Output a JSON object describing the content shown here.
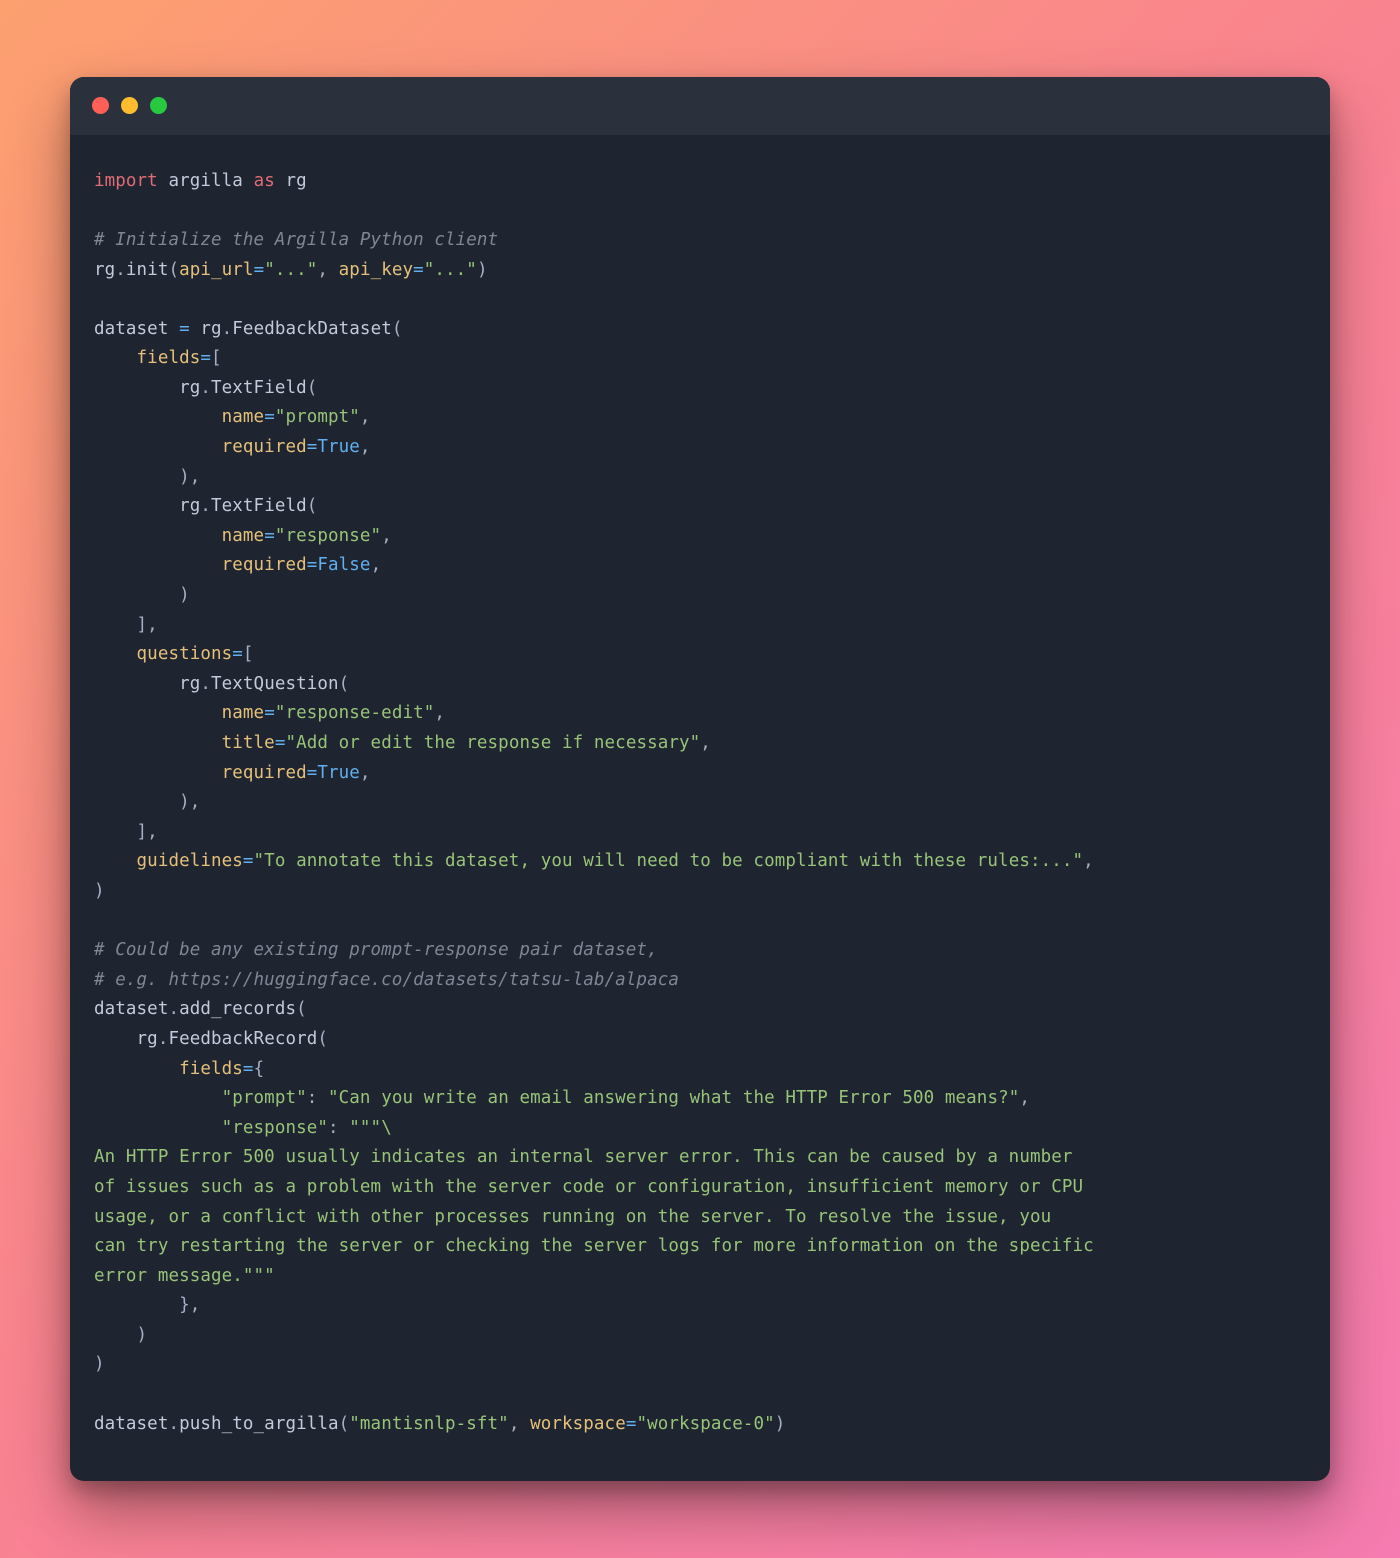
{
  "window": {
    "controls": [
      "close",
      "minimize",
      "zoom"
    ]
  },
  "code": {
    "line1": {
      "kw1": "import",
      "mod": "argilla",
      "kw2": "as",
      "alias": "rg"
    },
    "cmt_init": "# Initialize the Argilla Python client",
    "line_init": {
      "obj": "rg",
      "fn": "init",
      "p1": "api_url",
      "v1": "\"...\"",
      "p2": "api_key",
      "v2": "\"...\""
    },
    "ds_assign": {
      "var": "dataset",
      "cls": "rg",
      "ctor": "FeedbackDataset"
    },
    "fields_kw": "fields",
    "tf1": {
      "cls": "rg",
      "ctor": "TextField",
      "name_kw": "name",
      "name_v": "\"prompt\"",
      "req_kw": "required",
      "req_v": "True"
    },
    "tf2": {
      "cls": "rg",
      "ctor": "TextField",
      "name_kw": "name",
      "name_v": "\"response\"",
      "req_kw": "required",
      "req_v": "False"
    },
    "questions_kw": "questions",
    "tq": {
      "cls": "rg",
      "ctor": "TextQuestion",
      "name_kw": "name",
      "name_v": "\"response-edit\"",
      "title_kw": "title",
      "title_v": "\"Add or edit the response if necessary\"",
      "req_kw": "required",
      "req_v": "True"
    },
    "guidelines_kw": "guidelines",
    "guidelines_v": "\"To annotate this dataset, you will need to be compliant with these rules:...\"",
    "cmt_ds1": "# Could be any existing prompt-response pair dataset,",
    "cmt_ds2": "# e.g. https://huggingface.co/datasets/tatsu-lab/alpaca",
    "add": {
      "obj": "dataset",
      "fn": "add_records",
      "rec_cls": "rg",
      "rec_ctor": "FeedbackRecord",
      "fields_kw": "fields",
      "prompt_key": "\"prompt\"",
      "prompt_val": "\"Can you write an email answering what the HTTP Error 500 means?\"",
      "response_key": "\"response\"",
      "response_open": "\"\"\"\\",
      "response_body_l1": "An HTTP Error 500 usually indicates an internal server error. This can be caused by a number",
      "response_body_l2": "of issues such as a problem with the server code or configuration, insufficient memory or CPU",
      "response_body_l3": "usage, or a conflict with other processes running on the server. To resolve the issue, you",
      "response_body_l4": "can try restarting the server or checking the server logs for more information on the specific",
      "response_body_l5": "error message.\"\"\""
    },
    "push": {
      "obj": "dataset",
      "fn": "push_to_argilla",
      "arg1": "\"mantisnlp-sft\"",
      "ws_kw": "workspace",
      "ws_v": "\"workspace-0\""
    }
  }
}
